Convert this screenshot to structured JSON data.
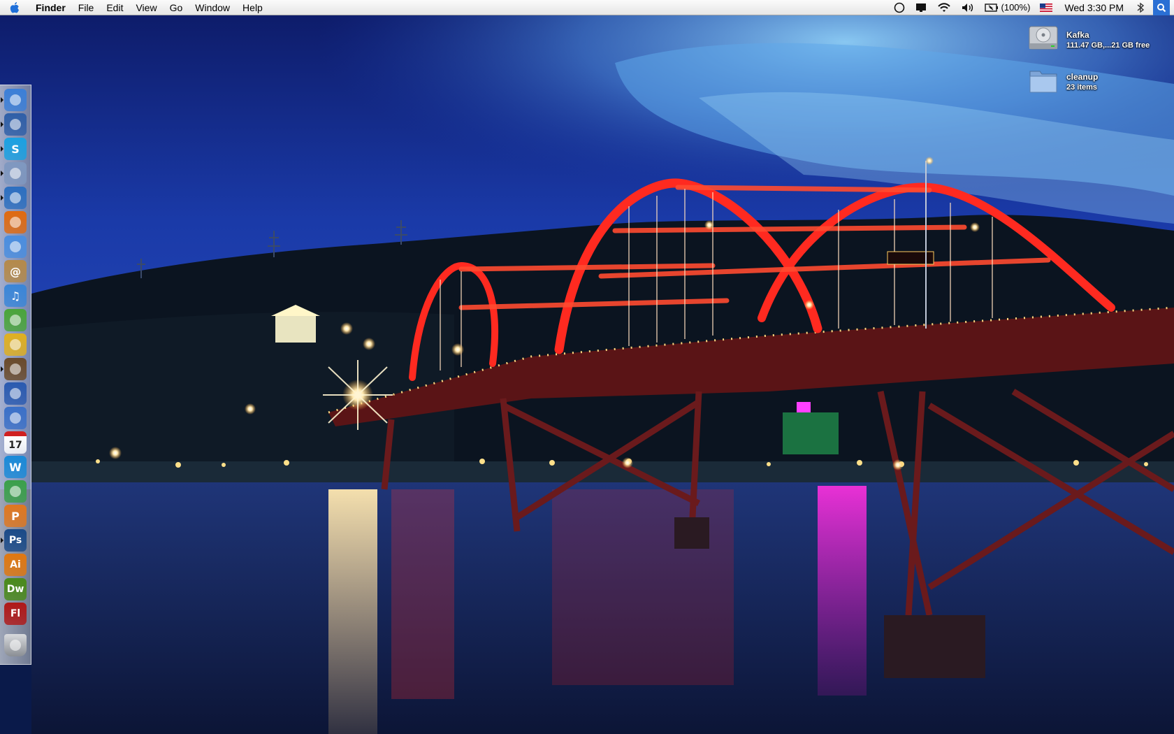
{
  "menubar": {
    "app_name": "Finder",
    "menus": [
      "File",
      "Edit",
      "View",
      "Go",
      "Window",
      "Help"
    ],
    "battery_text": "(100%)",
    "clock": "Wed 3:30 PM",
    "icons": [
      "apple-icon",
      "time-machine-icon",
      "display-icon",
      "wifi-icon",
      "volume-icon",
      "battery-icon",
      "us-flag-input-icon",
      "bluetooth-icon",
      "spotlight-icon"
    ]
  },
  "desktop": {
    "items": [
      {
        "name": "Kafka",
        "info": "111.47 GB,...21 GB free",
        "icon": "hard-drive-icon"
      },
      {
        "name": "cleanup",
        "info": "23 items",
        "icon": "folder-icon"
      }
    ]
  },
  "dock": {
    "position": "left",
    "items": [
      {
        "name": "finder",
        "label": "",
        "running": true,
        "color": "#3b7fd8"
      },
      {
        "name": "adium",
        "label": "",
        "running": true,
        "color": "#2f5fa8"
      },
      {
        "name": "skype",
        "label": "S",
        "running": true,
        "color": "#1ba1e2"
      },
      {
        "name": "mail",
        "label": "",
        "running": true,
        "color": "#7f98c0"
      },
      {
        "name": "safari",
        "label": "",
        "running": true,
        "color": "#2c6fc0"
      },
      {
        "name": "firefox",
        "label": "",
        "running": false,
        "color": "#e06a10"
      },
      {
        "name": "ichat",
        "label": "",
        "running": false,
        "color": "#4a8ee0"
      },
      {
        "name": "address-book",
        "label": "@",
        "running": false,
        "color": "#b58a4a"
      },
      {
        "name": "itunes",
        "label": "♫",
        "running": false,
        "color": "#3a86d8"
      },
      {
        "name": "evernote",
        "label": "",
        "running": false,
        "color": "#4aa53a"
      },
      {
        "name": "transmit",
        "label": "",
        "running": false,
        "color": "#e0b020"
      },
      {
        "name": "preview",
        "label": "",
        "running": true,
        "color": "#6a4a2a"
      },
      {
        "name": "imovie",
        "label": "",
        "running": false,
        "color": "#2a5ab0"
      },
      {
        "name": "dvd-player",
        "label": "",
        "running": false,
        "color": "#3a70c8"
      },
      {
        "name": "ical",
        "label": "17",
        "running": false,
        "color": "#ffffff"
      },
      {
        "name": "wacom",
        "label": "W",
        "running": false,
        "color": "#1a8ad8"
      },
      {
        "name": "grab",
        "label": "",
        "running": false,
        "color": "#3aa04a"
      },
      {
        "name": "pages",
        "label": "P",
        "running": false,
        "color": "#e07820"
      },
      {
        "name": "photoshop",
        "label": "Ps",
        "running": true,
        "color": "#1a4a88"
      },
      {
        "name": "illustrator",
        "label": "Ai",
        "running": false,
        "color": "#e07810"
      },
      {
        "name": "dreamweaver",
        "label": "Dw",
        "running": false,
        "color": "#4a8a1a"
      },
      {
        "name": "flash",
        "label": "Fl",
        "running": false,
        "color": "#b01818"
      },
      {
        "name": "trash",
        "label": "",
        "running": false,
        "color": "#8a8a8a"
      }
    ]
  },
  "colors": {
    "sky_top": "#0f1f6e",
    "sky_glow": "#6fb8f0",
    "bridge_red": "#ff2a20",
    "water": "#1a2a5a",
    "spotlight_blue": "#2a6fd4"
  }
}
